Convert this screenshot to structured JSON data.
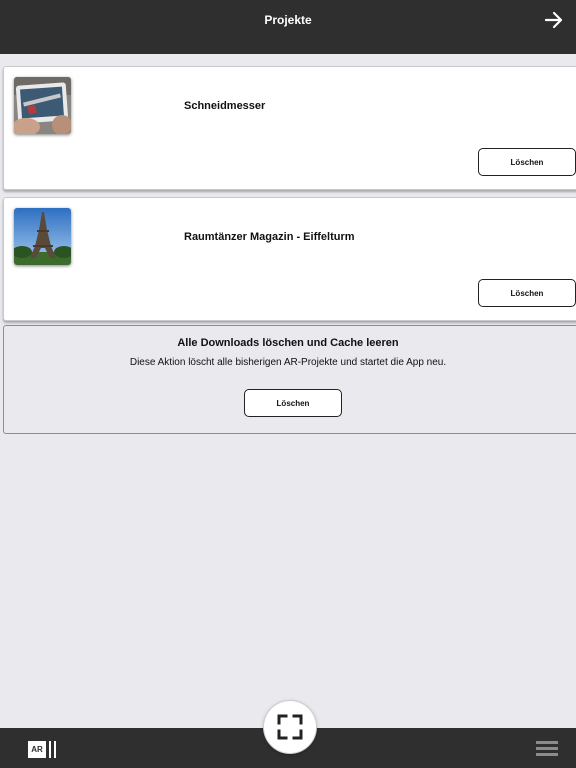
{
  "header": {
    "title": "Projekte",
    "forward_icon": "arrow-right-icon"
  },
  "projects": [
    {
      "title": "Schneidmesser",
      "thumbnail": "tablet-thumbnail",
      "delete_label": "Löschen"
    },
    {
      "title": "Raumtänzer Magazin - Eiffelturm",
      "thumbnail": "eiffel-tower-thumbnail",
      "delete_label": "Löschen"
    }
  ],
  "cache": {
    "title": "Alle Downloads löschen und Cache leeren",
    "description": "Diese Aktion löscht alle bisherigen AR-Projekte und startet die App neu.",
    "delete_label": "Löschen"
  },
  "footer": {
    "logo_text": "AR",
    "scan_icon": "scan-frame-icon",
    "menu_icon": "hamburger-menu-icon"
  },
  "colors": {
    "bar_background": "#2f2f2f",
    "page_background": "#e9e9ee",
    "card_background": "#ffffff"
  }
}
